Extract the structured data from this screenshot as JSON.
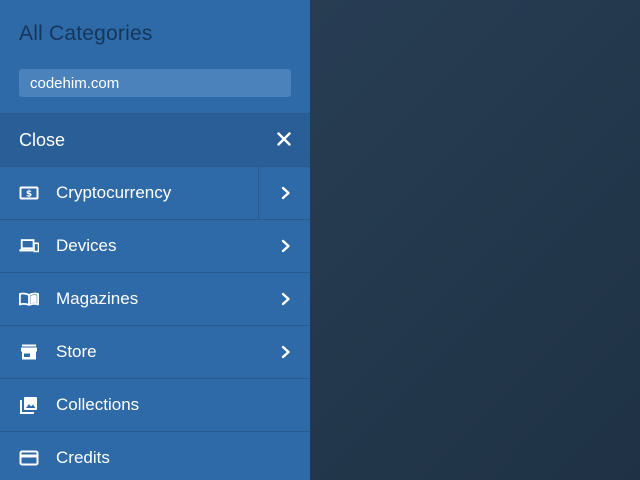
{
  "drawer": {
    "title": "All Categories",
    "search_value": "codehim.com",
    "close_label": "Close"
  },
  "menu": {
    "items": [
      {
        "label": "Cryptocurrency",
        "icon": "money-icon",
        "has_submenu": true
      },
      {
        "label": "Devices",
        "icon": "devices-icon",
        "has_submenu": true
      },
      {
        "label": "Magazines",
        "icon": "book-icon",
        "has_submenu": true
      },
      {
        "label": "Store",
        "icon": "store-icon",
        "has_submenu": true
      },
      {
        "label": "Collections",
        "icon": "collections-icon",
        "has_submenu": false
      },
      {
        "label": "Credits",
        "icon": "credit-card-icon",
        "has_submenu": false
      }
    ]
  },
  "colors": {
    "drawer_bg": "#2f6aa8",
    "close_row_bg": "#2a5e97",
    "title_text": "#15365a",
    "search_bg": "#4c82bb",
    "backdrop": "#253a4f",
    "text": "#ffffff"
  }
}
